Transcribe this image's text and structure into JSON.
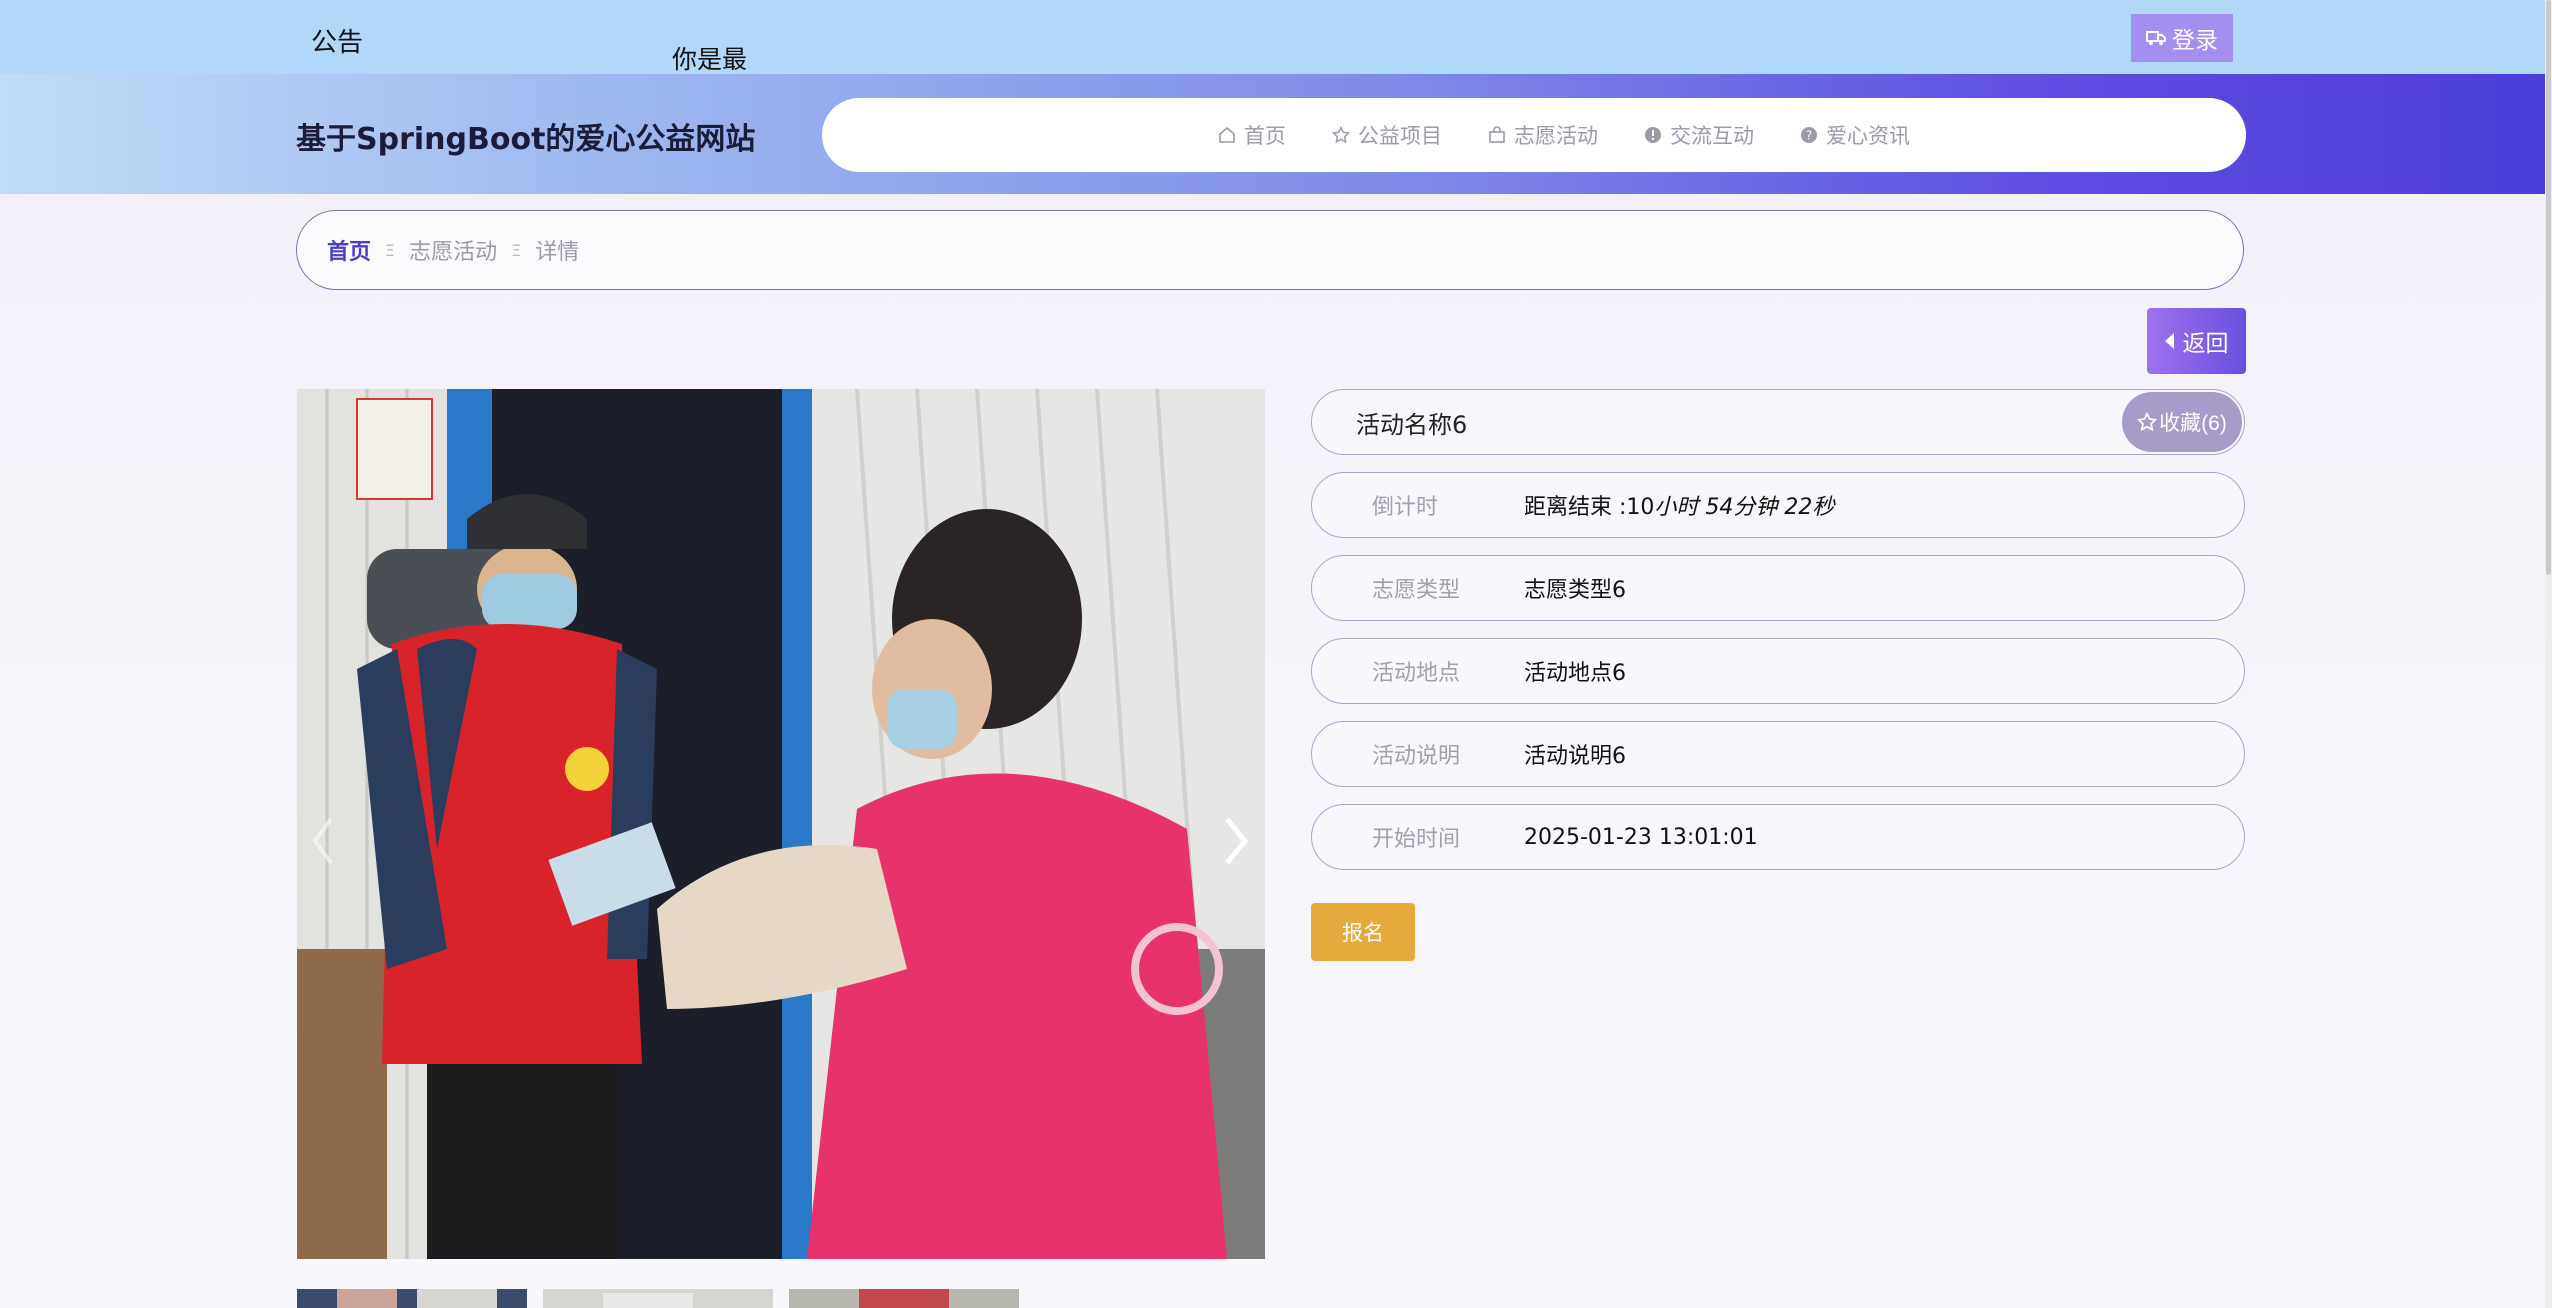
{
  "notice": {
    "label": "公告",
    "text": "你是最"
  },
  "login": {
    "label": "登录"
  },
  "site": {
    "title": "基于SpringBoot的爱心公益网站"
  },
  "nav": [
    {
      "label": "首页",
      "icon": "home-icon"
    },
    {
      "label": "公益项目",
      "icon": "star-icon"
    },
    {
      "label": "志愿活动",
      "icon": "bag-icon"
    },
    {
      "label": "交流互动",
      "icon": "info-icon"
    },
    {
      "label": "爱心资讯",
      "icon": "help-icon"
    }
  ],
  "breadcrumb": {
    "home": "首页",
    "section": "志愿活动",
    "current": "详情",
    "separator": "Ξ"
  },
  "back": {
    "label": "返回"
  },
  "detail": {
    "name": "活动名称6",
    "favorite": "收藏(6)",
    "rows": [
      {
        "label": "倒计时",
        "value_prefix": "距离结束 :10",
        "value_italic": "小时 54分钟 22秒"
      },
      {
        "label": "志愿类型",
        "value": "志愿类型6"
      },
      {
        "label": "活动地点",
        "value": "活动地点6"
      },
      {
        "label": "活动说明",
        "value": "活动说明6"
      },
      {
        "label": "开始时间",
        "value": "2025-01-23 13:01:01"
      }
    ]
  },
  "signup": {
    "label": "报名"
  },
  "colors": {
    "accent": "#4a3ec9",
    "signup": "#e5a93e",
    "favorite": "#a89ac9"
  }
}
